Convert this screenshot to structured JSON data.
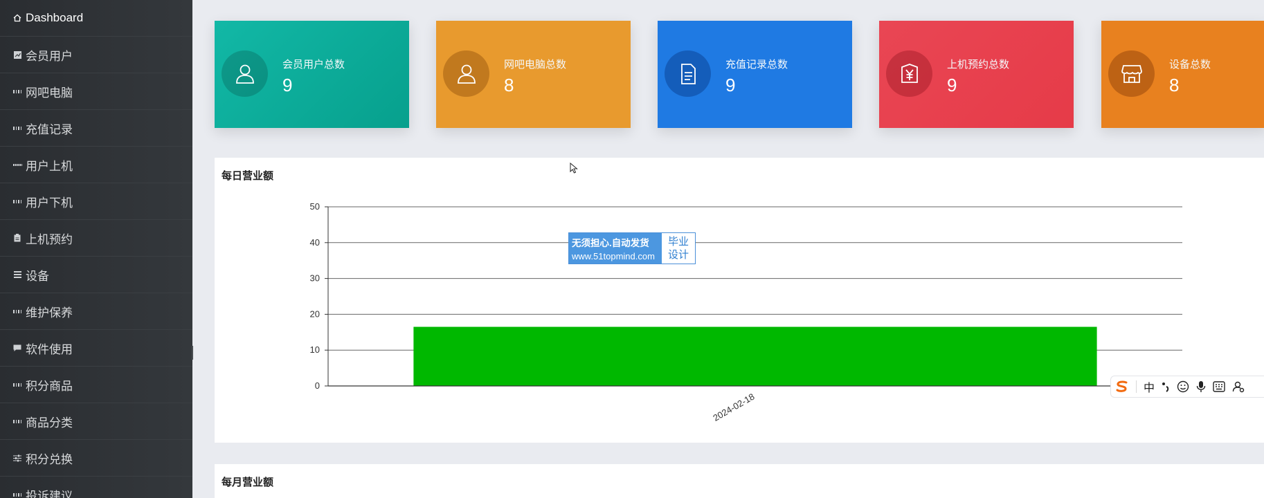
{
  "sidebar": {
    "items": [
      {
        "label": "Dashboard",
        "icon": "home-icon"
      },
      {
        "label": "会员用户",
        "icon": "chart-icon"
      },
      {
        "label": "网吧电脑",
        "icon": "grid-icon"
      },
      {
        "label": "充值记录",
        "icon": "grid-icon"
      },
      {
        "label": "用户上机",
        "icon": "grid-icon"
      },
      {
        "label": "用户下机",
        "icon": "grid-icon"
      },
      {
        "label": "上机预约",
        "icon": "clipboard-icon"
      },
      {
        "label": "设备",
        "icon": "list-icon"
      },
      {
        "label": "维护保养",
        "icon": "grid-icon"
      },
      {
        "label": "软件使用",
        "icon": "message-icon"
      },
      {
        "label": "积分商品",
        "icon": "grid-icon"
      },
      {
        "label": "商品分类",
        "icon": "grid-icon"
      },
      {
        "label": "积分兑换",
        "icon": "sliders-icon"
      },
      {
        "label": "投诉建议",
        "icon": "grid-icon"
      }
    ]
  },
  "cards": [
    {
      "label": "会员用户总数",
      "value": "9",
      "color": "#10b4a0",
      "icon": "user-icon"
    },
    {
      "label": "网吧电脑总数",
      "value": "8",
      "color": "#e89a2e",
      "icon": "user-icon"
    },
    {
      "label": "充值记录总数",
      "value": "9",
      "color": "#1f7ae3",
      "icon": "document-icon"
    },
    {
      "label": "上机预约总数",
      "value": "9",
      "color": "#e8434f",
      "icon": "yuan-icon"
    },
    {
      "label": "设备总数",
      "value": "8",
      "color": "#e8811f",
      "icon": "store-icon"
    }
  ],
  "panels": {
    "daily_title": "每日营业额",
    "monthly_title": "每月营业额"
  },
  "chart_data": {
    "type": "bar",
    "title": "每日营业额",
    "categories": [
      "2024-02-18"
    ],
    "values": [
      16.5
    ],
    "ylim": [
      0,
      50
    ],
    "yticks": [
      0,
      10,
      20,
      30,
      40,
      50
    ],
    "grid": true,
    "bar_color": "#00b800"
  },
  "watermark": {
    "line1": "无须担心.自动发货",
    "line2": "www.51topmind.com",
    "right1": "毕业",
    "right2": "设计"
  },
  "ime": {
    "mode": "中"
  }
}
